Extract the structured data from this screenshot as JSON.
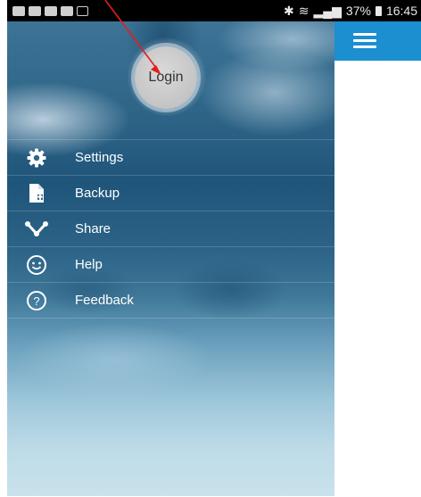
{
  "status_bar": {
    "battery_percent": "37%",
    "time": "16:45"
  },
  "toolbar": {
    "menu_icon": "hamburger-menu-icon",
    "background": "#1b8fd0"
  },
  "drawer": {
    "login_label": "Login",
    "items": [
      {
        "label": "Settings",
        "icon": "gear-icon"
      },
      {
        "label": "Backup",
        "icon": "backup-file-icon"
      },
      {
        "label": "Share",
        "icon": "share-icon"
      },
      {
        "label": "Help",
        "icon": "smiley-icon"
      },
      {
        "label": "Feedback",
        "icon": "question-icon"
      }
    ]
  },
  "annotation": {
    "color": "#e0201f",
    "target": "login-button"
  }
}
